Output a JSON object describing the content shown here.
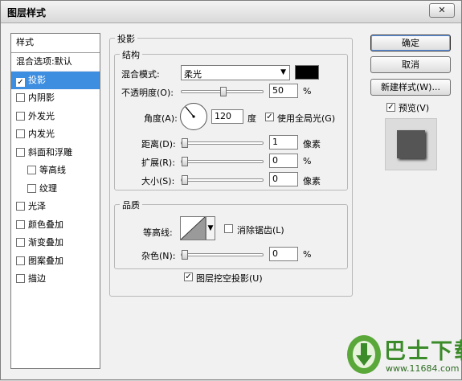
{
  "window": {
    "title": "图层样式",
    "close_glyph": "✕"
  },
  "style_list": {
    "header": "样式",
    "items": [
      {
        "label": "混合选项:默认",
        "type": "plain",
        "checked": false,
        "selected": false
      },
      {
        "label": "投影",
        "type": "check",
        "checked": true,
        "selected": true
      },
      {
        "label": "内阴影",
        "type": "check",
        "checked": false,
        "selected": false
      },
      {
        "label": "外发光",
        "type": "check",
        "checked": false,
        "selected": false
      },
      {
        "label": "内发光",
        "type": "check",
        "checked": false,
        "selected": false
      },
      {
        "label": "斜面和浮雕",
        "type": "check",
        "checked": false,
        "selected": false
      },
      {
        "label": "等高线",
        "type": "check-indent",
        "checked": false,
        "selected": false
      },
      {
        "label": "纹理",
        "type": "check-indent",
        "checked": false,
        "selected": false
      },
      {
        "label": "光泽",
        "type": "check",
        "checked": false,
        "selected": false
      },
      {
        "label": "颜色叠加",
        "type": "check",
        "checked": false,
        "selected": false
      },
      {
        "label": "渐变叠加",
        "type": "check",
        "checked": false,
        "selected": false
      },
      {
        "label": "图案叠加",
        "type": "check",
        "checked": false,
        "selected": false
      },
      {
        "label": "描边",
        "type": "check",
        "checked": false,
        "selected": false
      }
    ]
  },
  "drop_shadow": {
    "group_title": "投影",
    "structure": {
      "title": "结构",
      "blend_mode": {
        "label": "混合模式:",
        "value": "柔光",
        "color": "#000000"
      },
      "opacity": {
        "label": "不透明度(O):",
        "value": "50",
        "unit": "%",
        "level": 0.5
      },
      "angle": {
        "label": "角度(A):",
        "value": "120",
        "unit": "度",
        "use_global_label": "使用全局光(G)",
        "use_global": true
      },
      "distance": {
        "label": "距离(D):",
        "value": "1",
        "unit": "像素"
      },
      "spread": {
        "label": "扩展(R):",
        "value": "0",
        "unit": "%"
      },
      "size": {
        "label": "大小(S):",
        "value": "0",
        "unit": "像素"
      }
    },
    "quality": {
      "title": "品质",
      "contour_label": "等高线:",
      "anti_alias_label": "消除锯齿(L)",
      "anti_alias": false,
      "noise": {
        "label": "杂色(N):",
        "value": "0",
        "unit": "%"
      }
    },
    "knockout_label": "图层挖空投影(U)",
    "knockout": true
  },
  "buttons": {
    "ok": "确定",
    "cancel": "取消",
    "new_style": "新建样式(W)..."
  },
  "preview": {
    "label": "预览(V)",
    "checked": true
  },
  "watermark": {
    "brand": "巴士下载",
    "url": "www.11684.com",
    "icon": "download-logo-icon"
  }
}
